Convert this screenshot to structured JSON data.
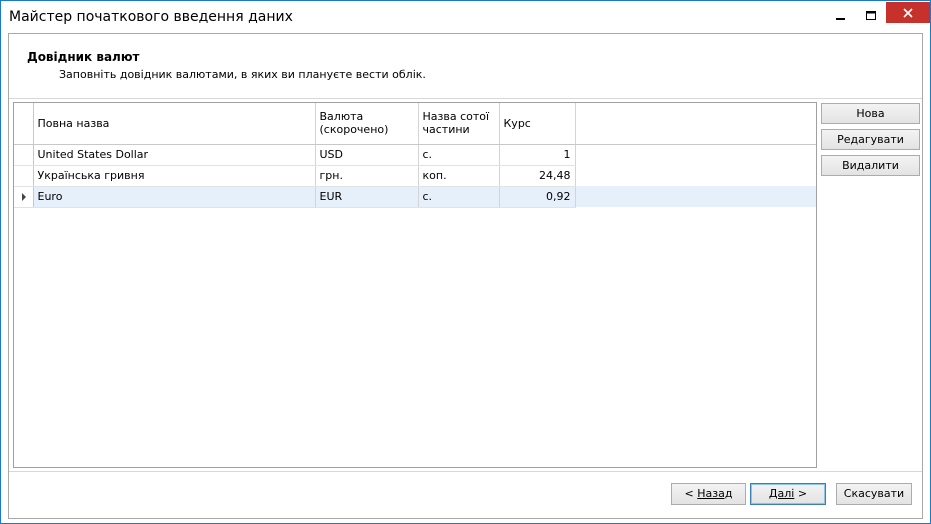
{
  "window": {
    "title": "Майстер початкового введення даних"
  },
  "header": {
    "title": "Довідник валют",
    "subtitle": "Заповніть довідник валютами, в яких ви плануєте вести облік."
  },
  "grid": {
    "columns": [
      {
        "label": "Повна назва"
      },
      {
        "label": "Валюта (скорочено)"
      },
      {
        "label": "Назва сотої частини"
      },
      {
        "label": "Курс"
      }
    ],
    "rows": [
      {
        "full_name": "United States Dollar",
        "code": "USD",
        "subunit": "с.",
        "rate": "1",
        "selected": false
      },
      {
        "full_name": "Українська гривня",
        "code": "грн.",
        "subunit": "коп.",
        "rate": "24,48",
        "selected": false
      },
      {
        "full_name": "Euro",
        "code": "EUR",
        "subunit": "с.",
        "rate": "0,92",
        "selected": true
      }
    ]
  },
  "side_buttons": {
    "new": "Нова",
    "edit": "Редагувати",
    "delete": "Видалити"
  },
  "footer": {
    "back_prefix": "< ",
    "back": "Назад",
    "next": "Далі",
    "next_suffix": " >",
    "cancel": "Скасувати"
  },
  "icons": {
    "minimize": "minimize-icon",
    "maximize": "maximize-icon",
    "close": "close-icon",
    "row_indicator": "row-pointer-icon"
  },
  "colors": {
    "window_border": "#1979ca",
    "close_button": "#c7312b",
    "selected_row": "#e6f0fb"
  }
}
